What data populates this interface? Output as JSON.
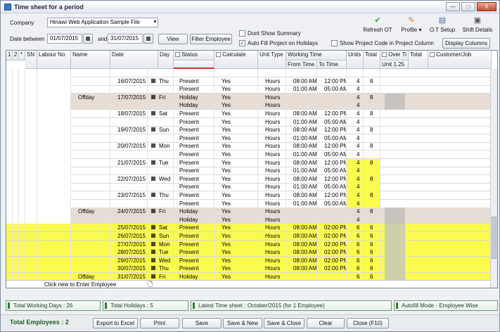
{
  "window": {
    "title": "Time sheet for a period",
    "min": "—",
    "max": "□",
    "close": "X"
  },
  "filters": {
    "company_label": "Company",
    "company_value": "Hinawi Web Application Sample File",
    "date_between_label": "Date between",
    "date_from": "01/07/2015",
    "and_label": "and",
    "date_to": "31/07/2015",
    "view_btn": "View",
    "filter_employee_btn": "Filter Employee",
    "dont_show_summary": "Dont Show Summary",
    "auto_fill_project": "Auto Fill Project on Holidays",
    "show_project_code": "Show Project Code in Project Column",
    "display_columns_btn": "Display Columns"
  },
  "toolbar": {
    "refresh": "Refresh OT",
    "profile": "Profile",
    "ot_setup": "O.T Setup",
    "shift_details": "Shift Details"
  },
  "columns": {
    "c1": "1",
    "c2": "2",
    "c3": "*",
    "sn": "SN",
    "labour_no": "Labour No.",
    "name": "Name",
    "date": "Date",
    "day": "Day",
    "status": "Status",
    "calculate": "Calculate",
    "unit_type": "Unit Type",
    "working_time": "Working Time",
    "from_time": "From Time",
    "to_time": "To Time",
    "units": "Units",
    "total": "Total",
    "over_time": "Over Ti",
    "unit125": "Unit 1.25",
    "total2": "Total",
    "customer_job": "Customer/Job"
  },
  "rows": [
    {
      "name": "",
      "date": "",
      "day": "",
      "status": "",
      "calc": "",
      "unit": "",
      "from": "",
      "to": "",
      "units": "",
      "total": ""
    },
    {
      "name": "",
      "date": "16/07/2015",
      "day": "Thu",
      "status": "Present",
      "calc": "Yes",
      "unit": "Hours",
      "from": "08:00 AM",
      "to": "12:00 PM",
      "units": "4",
      "total": "8"
    },
    {
      "name": "",
      "date": "",
      "day": "",
      "status": "Present",
      "calc": "Yes",
      "unit": "Hours",
      "from": "01:00 AM",
      "to": "05:00 AM",
      "units": "4",
      "total": ""
    },
    {
      "name": "Offday",
      "date": "17/07/2015",
      "day": "Fri",
      "status": "Holiday",
      "calc": "Yes",
      "unit": "Hours",
      "from": "",
      "to": "",
      "units": "4",
      "total": "8"
    },
    {
      "name": "",
      "date": "",
      "day": "",
      "status": "Holiday",
      "calc": "Yes",
      "unit": "Hours",
      "from": "",
      "to": "",
      "units": "4",
      "total": ""
    },
    {
      "name": "",
      "date": "18/07/2015",
      "day": "Sat",
      "status": "Present",
      "calc": "Yes",
      "unit": "Hours",
      "from": "08:00 AM",
      "to": "12:00 PM",
      "units": "4",
      "total": "8"
    },
    {
      "name": "",
      "date": "",
      "day": "",
      "status": "Present",
      "calc": "Yes",
      "unit": "Hours",
      "from": "01:00 AM",
      "to": "05:00 AM",
      "units": "4",
      "total": ""
    },
    {
      "name": "",
      "date": "19/07/2015",
      "day": "Sun",
      "status": "Present",
      "calc": "Yes",
      "unit": "Hours",
      "from": "08:00 AM",
      "to": "12:00 PM",
      "units": "4",
      "total": "8"
    },
    {
      "name": "",
      "date": "",
      "day": "",
      "status": "Present",
      "calc": "Yes",
      "unit": "Hours",
      "from": "01:00 AM",
      "to": "05:00 AM",
      "units": "4",
      "total": ""
    },
    {
      "name": "",
      "date": "20/07/2015",
      "day": "Mon",
      "status": "Present",
      "calc": "Yes",
      "unit": "Hours",
      "from": "08:00 AM",
      "to": "12:00 PM",
      "units": "4",
      "total": "8"
    },
    {
      "name": "",
      "date": "",
      "day": "",
      "status": "Present",
      "calc": "Yes",
      "unit": "Hours",
      "from": "01:00 AM",
      "to": "05:00 AM",
      "units": "4",
      "total": ""
    },
    {
      "name": "",
      "date": "21/07/2015",
      "day": "Tue",
      "status": "Present",
      "calc": "Yes",
      "unit": "Hours",
      "from": "08:00 AM",
      "to": "12:00 PM",
      "units": "4",
      "total": "8"
    },
    {
      "name": "",
      "date": "",
      "day": "",
      "status": "Present",
      "calc": "Yes",
      "unit": "Hours",
      "from": "01:00 AM",
      "to": "05:00 AM",
      "units": "4",
      "total": ""
    },
    {
      "name": "",
      "date": "22/07/2015",
      "day": "Wed",
      "status": "Present",
      "calc": "Yes",
      "unit": "Hours",
      "from": "08:00 AM",
      "to": "12:00 PM",
      "units": "4",
      "total": "8"
    },
    {
      "name": "",
      "date": "",
      "day": "",
      "status": "Present",
      "calc": "Yes",
      "unit": "Hours",
      "from": "01:00 AM",
      "to": "05:00 AM",
      "units": "4",
      "total": ""
    },
    {
      "name": "",
      "date": "23/07/2015",
      "day": "Thu",
      "status": "Present",
      "calc": "Yes",
      "unit": "Hours",
      "from": "08:00 AM",
      "to": "12:00 PM",
      "units": "4",
      "total": "8"
    },
    {
      "name": "",
      "date": "",
      "day": "",
      "status": "Present",
      "calc": "Yes",
      "unit": "Hours",
      "from": "01:00 AM",
      "to": "05:00 AM",
      "units": "4",
      "total": ""
    },
    {
      "name": "Offday",
      "date": "24/07/2015",
      "day": "Fri",
      "status": "Holiday",
      "calc": "Yes",
      "unit": "Hours",
      "from": "",
      "to": "",
      "units": "4",
      "total": "8"
    },
    {
      "name": "",
      "date": "",
      "day": "",
      "status": "Holiday",
      "calc": "Yes",
      "unit": "Hours",
      "from": "",
      "to": "",
      "units": "4",
      "total": ""
    },
    {
      "name": "",
      "date": "25/07/2015",
      "day": "Sat",
      "status": "Present",
      "calc": "Yes",
      "unit": "Hours",
      "from": "08:00 AM",
      "to": "02:00 PM",
      "units": "6",
      "total": "6"
    },
    {
      "name": "",
      "date": "26/07/2015",
      "day": "Sun",
      "status": "Present",
      "calc": "Yes",
      "unit": "Hours",
      "from": "08:00 AM",
      "to": "02:00 PM",
      "units": "6",
      "total": "6"
    },
    {
      "name": "",
      "date": "27/07/2015",
      "day": "Mon",
      "status": "Present",
      "calc": "Yes",
      "unit": "Hours",
      "from": "08:00 AM",
      "to": "02:00 PM",
      "units": "6",
      "total": "6"
    },
    {
      "name": "",
      "date": "28/07/2015",
      "day": "Tue",
      "status": "Present",
      "calc": "Yes",
      "unit": "Hours",
      "from": "08:00 AM",
      "to": "02:00 PM",
      "units": "6",
      "total": "6"
    },
    {
      "name": "",
      "date": "29/07/2015",
      "day": "Wed",
      "status": "Present",
      "calc": "Yes",
      "unit": "Hours",
      "from": "08:00 AM",
      "to": "02:00 PM",
      "units": "6",
      "total": "6"
    },
    {
      "name": "",
      "date": "30/07/2015",
      "day": "Thu",
      "status": "Present",
      "calc": "Yes",
      "unit": "Hours",
      "from": "08:00 AM",
      "to": "02:00 PM",
      "units": "6",
      "total": "6"
    },
    {
      "name": "Offday",
      "date": "31/07/2015",
      "day": "Fri",
      "status": "Holiday",
      "calc": "Yes",
      "unit": "Hours",
      "from": "",
      "to": "",
      "units": "6",
      "total": "6"
    }
  ],
  "new_row_text": "Click new to Enter Employee",
  "status": {
    "working_days": "Total Working Days : 26",
    "holidays": "Total Holidays : 5",
    "latest": "Latest Time sheet : October/2015 (for 1 Employee)",
    "autofill": "Autofill Mode - Employee Wise"
  },
  "footer": {
    "total_employees": "Total Employees : 2",
    "export": "Export to Excel",
    "print": "Print",
    "save": "Save",
    "save_new": "Save & New",
    "save_close": "Save & Close",
    "clear": "Clear",
    "close": "Close (F10)"
  },
  "colors": {
    "holiday_bg": "#e8ddd4",
    "highlight": "#fbfb4f",
    "present_bg": "#ffffff"
  }
}
